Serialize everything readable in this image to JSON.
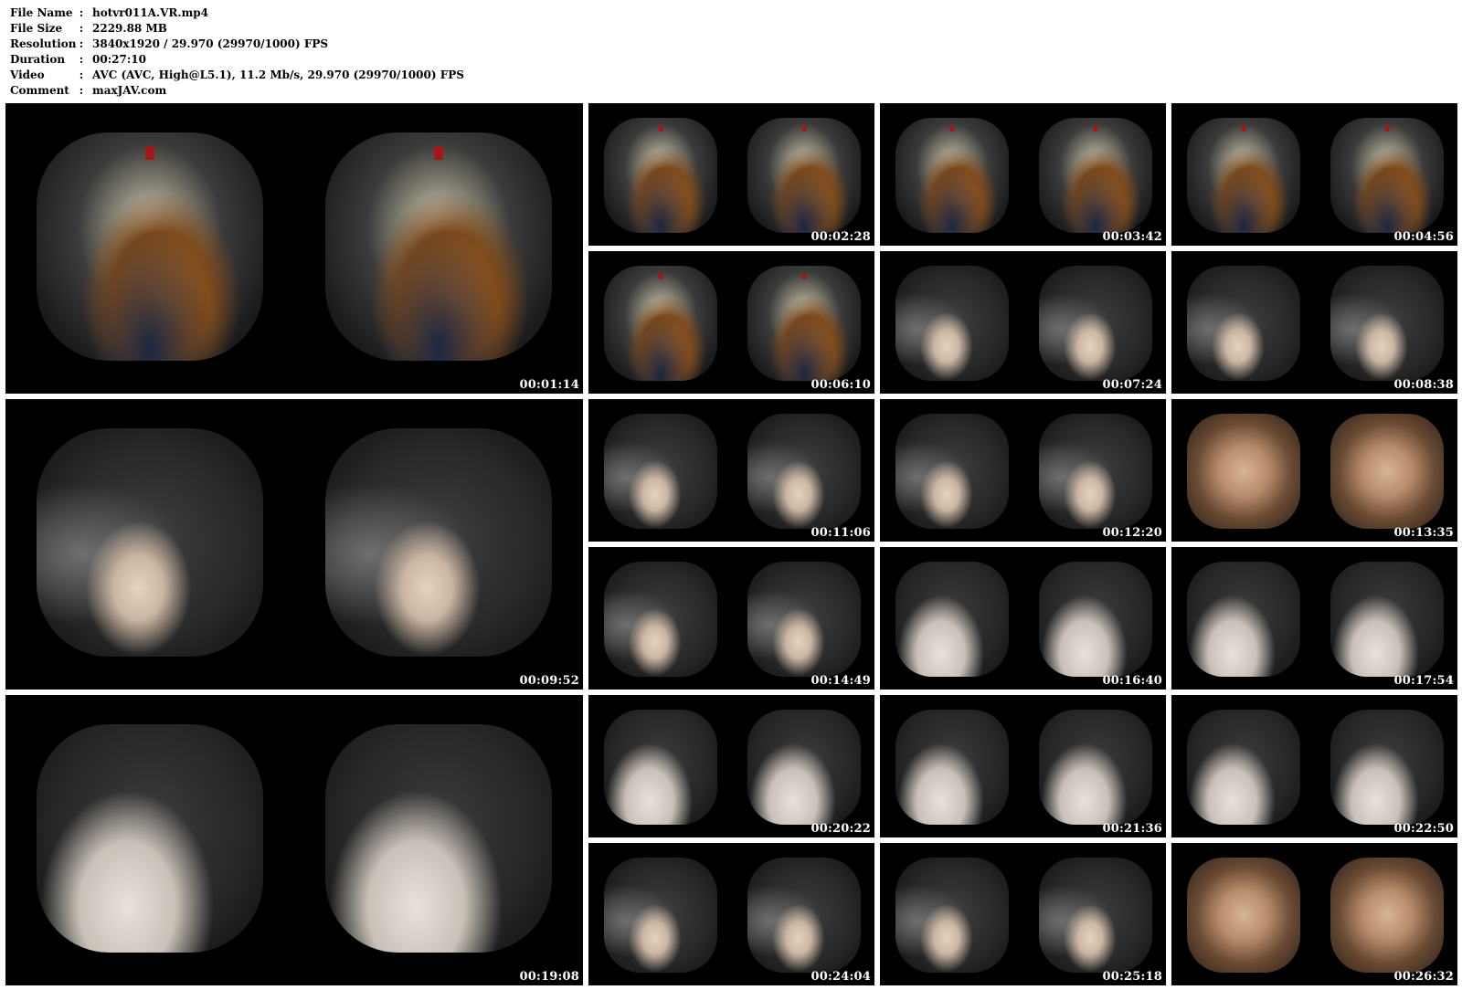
{
  "meta": {
    "rows": [
      {
        "label": "File Name",
        "sep": ":",
        "value": "hotvr011A.VR.mp4"
      },
      {
        "label": "File Size",
        "sep": ":",
        "value": "2229.88 MB"
      },
      {
        "label": "Resolution",
        "sep": ":",
        "value": "3840x1920 / 29.970 (29970/1000) FPS"
      },
      {
        "label": "Duration",
        "sep": ":",
        "value": "00:27:10"
      },
      {
        "label": "Video",
        "sep": ":",
        "value": "AVC (AVC, High@L5.1), 11.2 Mb/s, 29.970 (29970/1000) FPS"
      },
      {
        "label": "Comment",
        "sep": ":",
        "value": "maxJAV.com"
      }
    ]
  },
  "thumbs": [
    {
      "time": "00:01:14",
      "scene": "bar"
    },
    {
      "time": "00:02:28",
      "scene": "bar"
    },
    {
      "time": "00:03:42",
      "scene": "bar"
    },
    {
      "time": "00:04:56",
      "scene": "bar"
    },
    {
      "time": "00:06:10",
      "scene": "bar"
    },
    {
      "time": "00:07:24",
      "scene": "room"
    },
    {
      "time": "00:08:38",
      "scene": "room"
    },
    {
      "time": "00:09:52",
      "scene": "room"
    },
    {
      "time": "00:11:06",
      "scene": "room"
    },
    {
      "time": "00:12:20",
      "scene": "room"
    },
    {
      "time": "00:13:35",
      "scene": "close"
    },
    {
      "time": "00:14:49",
      "scene": "room"
    },
    {
      "time": "00:16:40",
      "scene": "bed"
    },
    {
      "time": "00:17:54",
      "scene": "bed"
    },
    {
      "time": "00:19:08",
      "scene": "bed"
    },
    {
      "time": "00:20:22",
      "scene": "bed"
    },
    {
      "time": "00:21:36",
      "scene": "bed"
    },
    {
      "time": "00:22:50",
      "scene": "bed"
    },
    {
      "time": "00:24:04",
      "scene": "room"
    },
    {
      "time": "00:25:18",
      "scene": "room"
    },
    {
      "time": "00:26:32",
      "scene": "close"
    }
  ]
}
